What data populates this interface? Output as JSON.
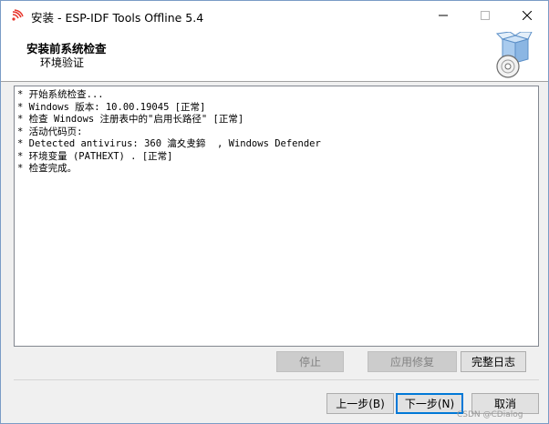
{
  "window": {
    "title": "安装 - ESP-IDF Tools Offline 5.4"
  },
  "header": {
    "title": "安装前系统检查",
    "subtitle": "环境验证"
  },
  "log": {
    "lines": [
      "* 开始系统检查...",
      "* Windows 版本: 10.00.19045 [正常]",
      "* 检查 Windows 注册表中的\"启用长路径\" [正常]",
      "* 活动代码页:",
      "* Detected antivirus: 360 瀹夊叏鍗  , Windows Defender",
      "* 环境变量 (PATHEXT) . [正常]",
      "* 检查完成。"
    ]
  },
  "actions": {
    "stop_label": "停止",
    "repair_label": "应用修复",
    "full_log_label": "完整日志"
  },
  "nav": {
    "back_label": "上一步(B)",
    "next_label": "下一步(N)",
    "cancel_label": "取消"
  },
  "watermark": "CSDN @CDialog"
}
